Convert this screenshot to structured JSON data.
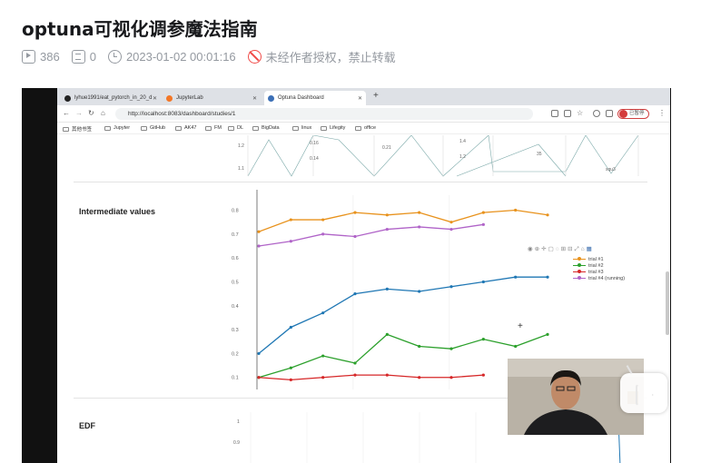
{
  "article": {
    "title": "optuna可视化调参魔法指南",
    "views": "386",
    "comments": "0",
    "published": "2023-01-02 00:01:16",
    "copyright": "未经作者授权，禁止转载",
    "copyright_color": "#f04c49"
  },
  "browser": {
    "tabs": [
      {
        "label": "lyhue1991/eat_pytorch_in_20_d",
        "icon": "github-icon"
      },
      {
        "label": "JupyterLab",
        "icon": "jupyter-icon"
      },
      {
        "label": "Optuna Dashboard",
        "icon": "optuna-icon"
      }
    ],
    "url": "http://localhost:8083/dashboard/studies/1",
    "profile_label": "已暂停",
    "bookmarks": [
      "其他书签",
      "Jupyter",
      "GitHub",
      "AK47",
      "FM",
      "DL",
      "BigData",
      "linux",
      "Lifegity",
      "office"
    ]
  },
  "dashboard": {
    "top_plot_labels": [
      "1.2",
      "1.1",
      "0.16",
      "0.14",
      "0.21",
      "1.4",
      "1.2",
      "35",
      "squ3"
    ],
    "intermediate_title": "Intermediate values",
    "edf_title": "EDF",
    "edf_ticks": [
      "1",
      "0.9"
    ],
    "legend": [
      {
        "name": "trial #1",
        "color": "#e8921c"
      },
      {
        "name": "trial #2",
        "color": "#2ca02c"
      },
      {
        "name": "trial #3",
        "color": "#d62728"
      },
      {
        "name": "trial #4 (running)",
        "color": "#b064c8"
      }
    ],
    "trial0_color": "#1f77b4"
  },
  "chart_data": {
    "type": "line",
    "title": "Intermediate values",
    "xlabel": "",
    "ylabel": "",
    "ylim": [
      0.08,
      0.84
    ],
    "yticks": [
      0.1,
      0.2,
      0.3,
      0.4,
      0.5,
      0.6,
      0.7,
      0.8
    ],
    "x": [
      0,
      1,
      2,
      3,
      4,
      5,
      6,
      7,
      8,
      9
    ],
    "series": [
      {
        "values": [
          0.2,
          0.31,
          0.37,
          0.45,
          0.47,
          0.46,
          0.48,
          0.5,
          0.52,
          0.52
        ]
      },
      {
        "name": "trial #1",
        "values": [
          0.71,
          0.76,
          0.76,
          0.79,
          0.78,
          0.79,
          0.75,
          0.79,
          0.8,
          0.78
        ]
      },
      {
        "name": "trial #2",
        "values": [
          0.1,
          0.14,
          0.19,
          0.16,
          0.28,
          0.23,
          0.22,
          0.26,
          0.23,
          0.28
        ]
      },
      {
        "name": "trial #3",
        "values": [
          0.1,
          0.09,
          0.1,
          0.11,
          0.11,
          0.1,
          0.1,
          0.11
        ]
      },
      {
        "name": "trial #4 (running)",
        "values": [
          0.65,
          0.67,
          0.7,
          0.69,
          0.72,
          0.73,
          0.72,
          0.74
        ]
      }
    ]
  }
}
